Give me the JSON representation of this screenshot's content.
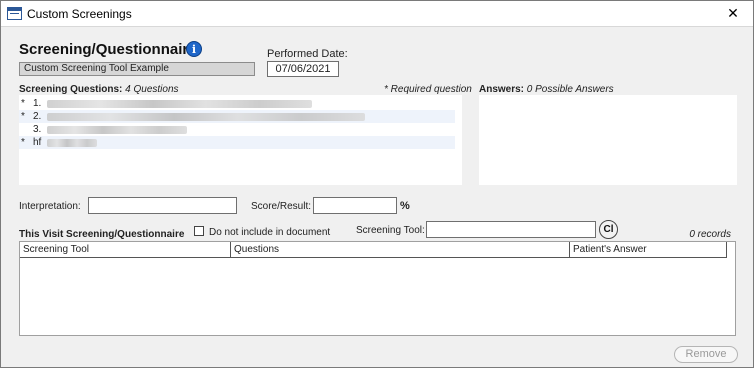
{
  "window": {
    "title": "Custom Screenings",
    "close_symbol": "✕",
    "icon": "table-window-icon"
  },
  "header": {
    "section_title": "Screening/Questionnaire",
    "info_symbol": "i",
    "tool_name": "Custom Screening Tool Example",
    "performed_date_label": "Performed Date:",
    "performed_date_value": "07/06/2021"
  },
  "questions": {
    "label": "Screening Questions:",
    "count_text": "4 Questions",
    "required_note": "* Required question",
    "rows": [
      {
        "required": "*",
        "number": "1.",
        "blurred": true
      },
      {
        "required": "*",
        "number": "2.",
        "blurred": true
      },
      {
        "required": "",
        "number": "3.",
        "blurred": true
      },
      {
        "required": "*",
        "number": "hf",
        "blurred": true
      }
    ]
  },
  "answers": {
    "label": "Answers:",
    "count_text": "0 Possible Answers"
  },
  "fields": {
    "interpretation_label": "Interpretation:",
    "interpretation_value": "",
    "score_label": "Score/Result:",
    "score_value": "",
    "percent_symbol": "%"
  },
  "visit": {
    "label": "This Visit Screening/Questionnaire",
    "exclude_checkbox_label": "Do not include in document",
    "exclude_checked": false,
    "tool_label": "Screening Tool:",
    "tool_value": "",
    "cl_button_label": "Cl",
    "records_text": "0 records"
  },
  "grid": {
    "columns": [
      "Screening Tool",
      "Questions",
      "Patient's Answer"
    ],
    "rows": []
  },
  "buttons": {
    "remove_label": "Remove"
  }
}
